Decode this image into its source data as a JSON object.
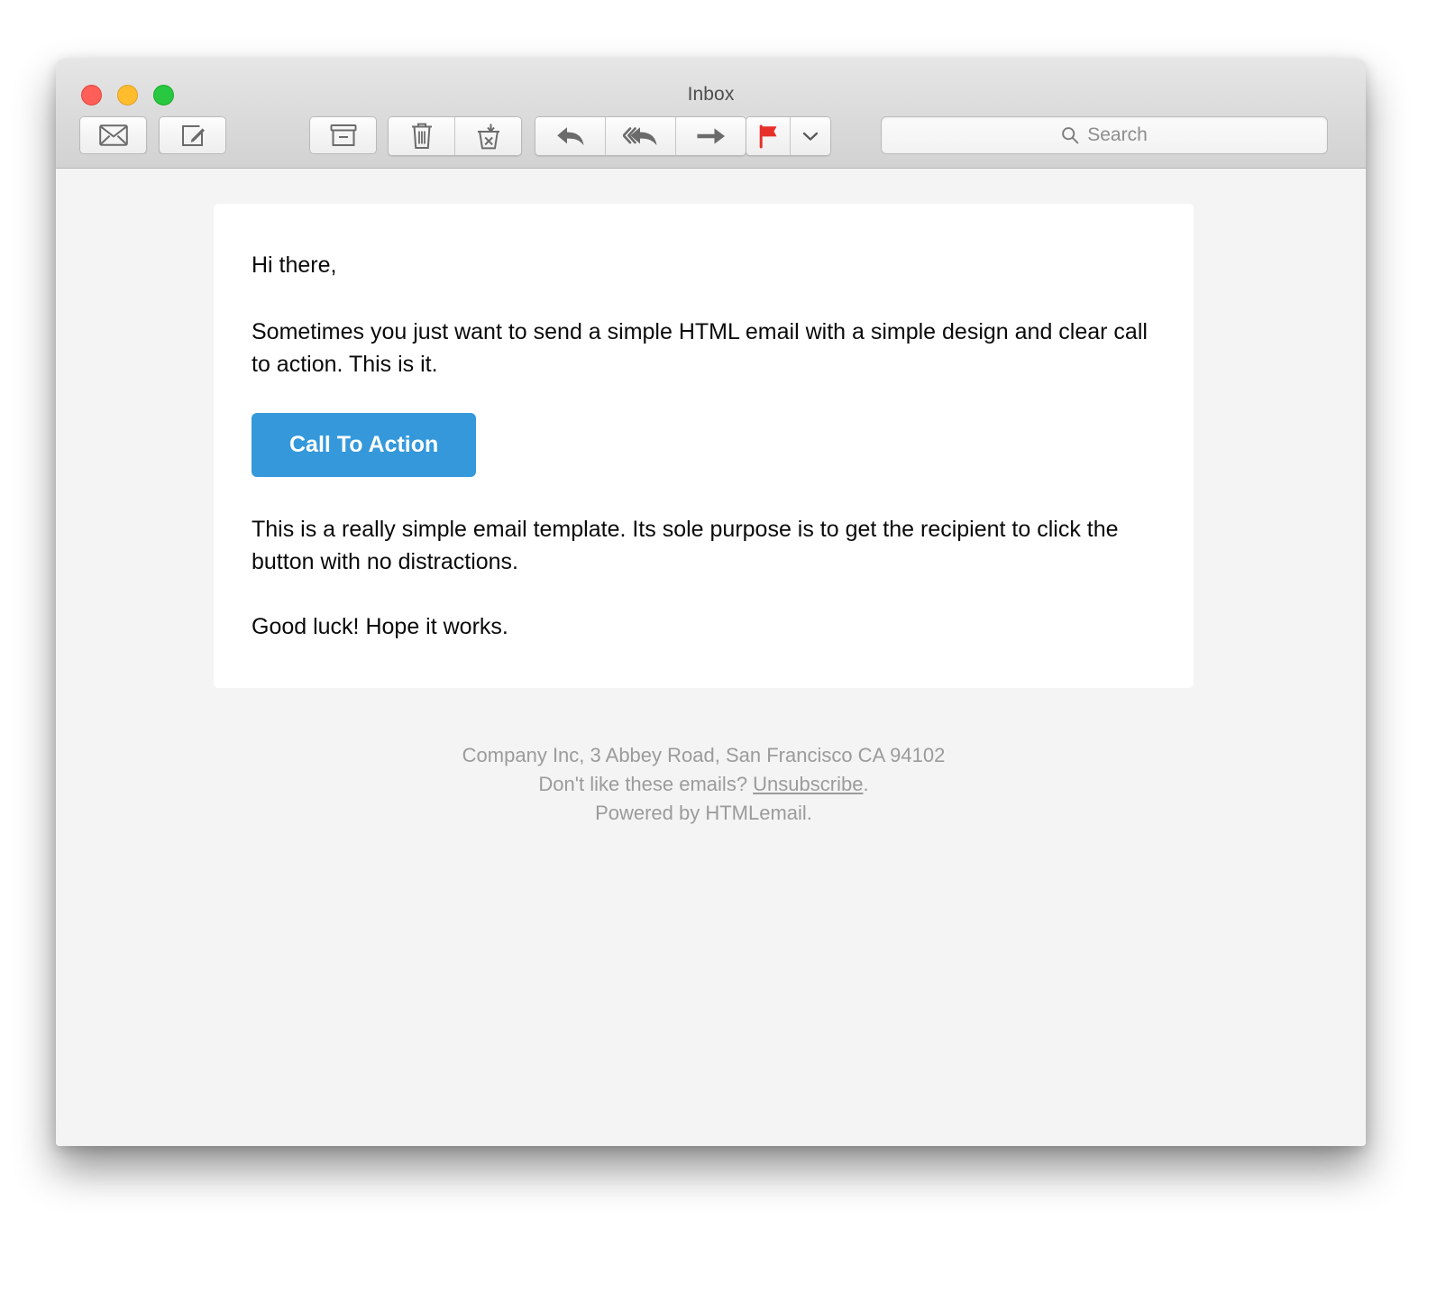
{
  "window": {
    "title": "Inbox",
    "traffic_lights": [
      {
        "name": "close",
        "color": "#ff5f57"
      },
      {
        "name": "minimize",
        "color": "#ffbd2e"
      },
      {
        "name": "zoom",
        "color": "#28c840"
      }
    ]
  },
  "toolbar": {
    "buttons": [
      {
        "icon": "mail-icon",
        "label": "Get Mail"
      },
      {
        "icon": "compose-icon",
        "label": "Compose"
      },
      {
        "icon": "archive-icon",
        "label": "Archive"
      },
      {
        "icon": "trash-icon",
        "label": "Delete"
      },
      {
        "icon": "junk-icon",
        "label": "Junk"
      },
      {
        "icon": "reply-icon",
        "label": "Reply"
      },
      {
        "icon": "reply-all-icon",
        "label": "Reply All"
      },
      {
        "icon": "forward-icon",
        "label": "Forward"
      },
      {
        "icon": "flag-icon",
        "label": "Flag"
      },
      {
        "icon": "chevron-down-icon",
        "label": "Flag Options"
      }
    ],
    "flag_color": "#e8302a"
  },
  "search": {
    "placeholder": "Search",
    "value": "",
    "icon": "search-icon"
  },
  "email": {
    "greeting": "Hi there,",
    "intro": "Sometimes you just want to send a simple HTML email with a simple design and clear call to action. This is it.",
    "cta_label": "Call To Action",
    "cta_color": "#3498db",
    "explanation": "This is a really simple email template. Its sole purpose is to get the recipient to click the button with no distractions.",
    "closing": "Good luck! Hope it works."
  },
  "footer": {
    "address": "Company Inc, 3 Abbey Road, San Francisco CA 94102",
    "unsubscribe_prefix": "Don't like these emails? ",
    "unsubscribe_label": "Unsubscribe",
    "unsubscribe_suffix": ".",
    "powered_by": "Powered by HTMLemail."
  }
}
